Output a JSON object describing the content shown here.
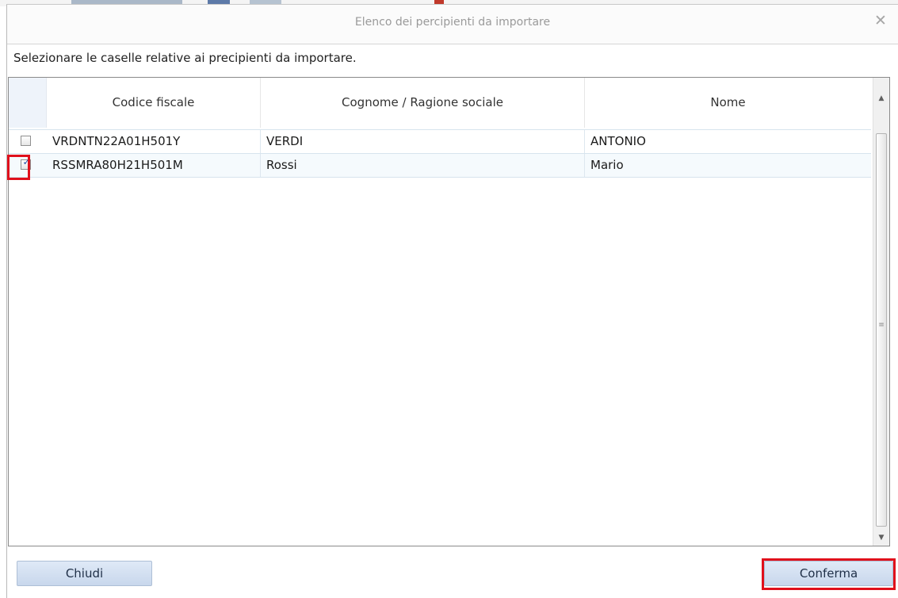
{
  "dialog": {
    "title": "Elenco dei percipienti da importare",
    "close_icon": "close-icon"
  },
  "instructions": "Selezionare le caselle relative ai precipienti da importare.",
  "grid": {
    "columns": [
      "Codice fiscale",
      "Cognome / Ragione sociale",
      "Nome"
    ],
    "rows": [
      {
        "checked": false,
        "codice_fiscale": "VRDNTN22A01H501Y",
        "cognome": "VERDI",
        "nome": "ANTONIO"
      },
      {
        "checked": true,
        "codice_fiscale": "RSSMRA80H21H501M",
        "cognome": "Rossi",
        "nome": "Mario"
      }
    ]
  },
  "buttons": {
    "close_label": "Chiudi",
    "confirm_label": "Conferma"
  },
  "colors": {
    "highlight": "#e0101c",
    "button_blue": "#c8d7ec",
    "row_border": "#d7e4ee"
  },
  "icons": {
    "scroll_up": "chevron-up-icon",
    "scroll_down": "chevron-down-icon",
    "scroll_grip": "grip-icon"
  }
}
